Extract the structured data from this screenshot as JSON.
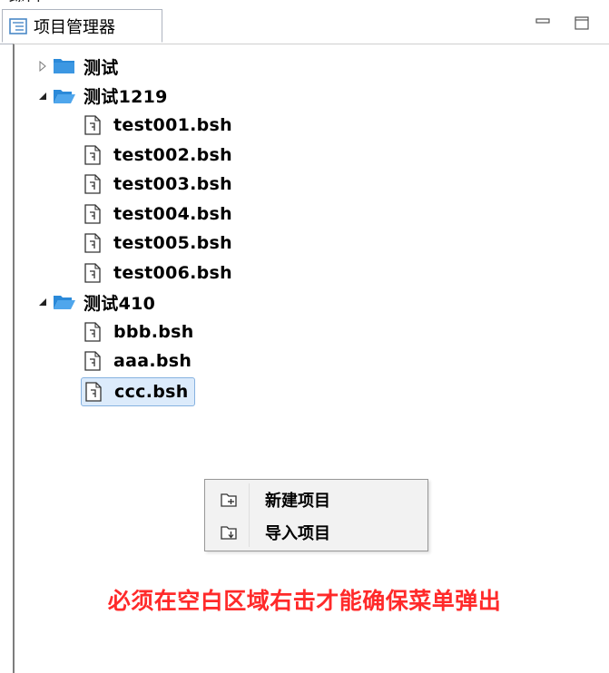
{
  "window": {
    "partial_top_label": "项目"
  },
  "tabs": [
    {
      "label": "项目管理器",
      "icon": "project-explorer-icon"
    }
  ],
  "window_buttons": [
    {
      "name": "minimize-button",
      "icon": "minimize-icon"
    },
    {
      "name": "maximize-button",
      "icon": "maximize-icon"
    }
  ],
  "tree": {
    "nodes": [
      {
        "label": "测试",
        "type": "folder",
        "expanded": false
      },
      {
        "label": "测试1219",
        "type": "folder",
        "expanded": true,
        "children": [
          "test001.bsh",
          "test002.bsh",
          "test003.bsh",
          "test004.bsh",
          "test005.bsh",
          "test006.bsh"
        ]
      },
      {
        "label": "测试410",
        "type": "folder",
        "expanded": true,
        "children": [
          "bbb.bsh",
          "aaa.bsh",
          "ccc.bsh"
        ]
      }
    ],
    "selected": "ccc.bsh"
  },
  "context_menu": {
    "items": [
      {
        "label": "新建项目",
        "icon": "new-project-icon"
      },
      {
        "label": "导入项目",
        "icon": "import-project-icon"
      }
    ]
  },
  "notice": {
    "text": "必须在空白区域右击才能确保菜单弹出",
    "color": "#ff2a2a"
  },
  "colors": {
    "folder": "#2b8ad9",
    "selection_bg": "#dcebfb",
    "selection_border": "#86b2e0"
  }
}
